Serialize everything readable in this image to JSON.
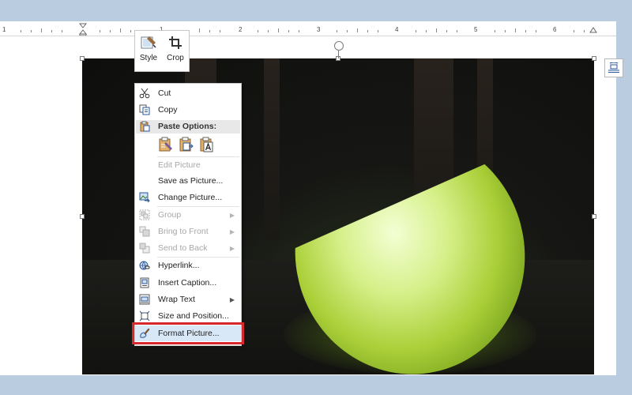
{
  "ruler": {
    "numbers": [
      "1",
      "1",
      "2",
      "3",
      "4",
      "5",
      "6"
    ]
  },
  "mini_toolbar": {
    "style_label": "Style",
    "crop_label": "Crop"
  },
  "context_menu": {
    "cut": "Cut",
    "copy": "Copy",
    "paste_options": "Paste Options:",
    "edit_picture": "Edit Picture",
    "save_as_picture": "Save as Picture...",
    "change_picture": "Change Picture...",
    "group": "Group",
    "bring_to_front": "Bring to Front",
    "send_to_back": "Send to Back",
    "hyperlink": "Hyperlink...",
    "insert_caption": "Insert Caption...",
    "wrap_text": "Wrap Text",
    "size_and_position": "Size and Position...",
    "format_picture": "Format Picture..."
  },
  "colors": {
    "highlight_border": "#d7262c",
    "background": "#b9cce0",
    "lamp": "#aacf38"
  }
}
